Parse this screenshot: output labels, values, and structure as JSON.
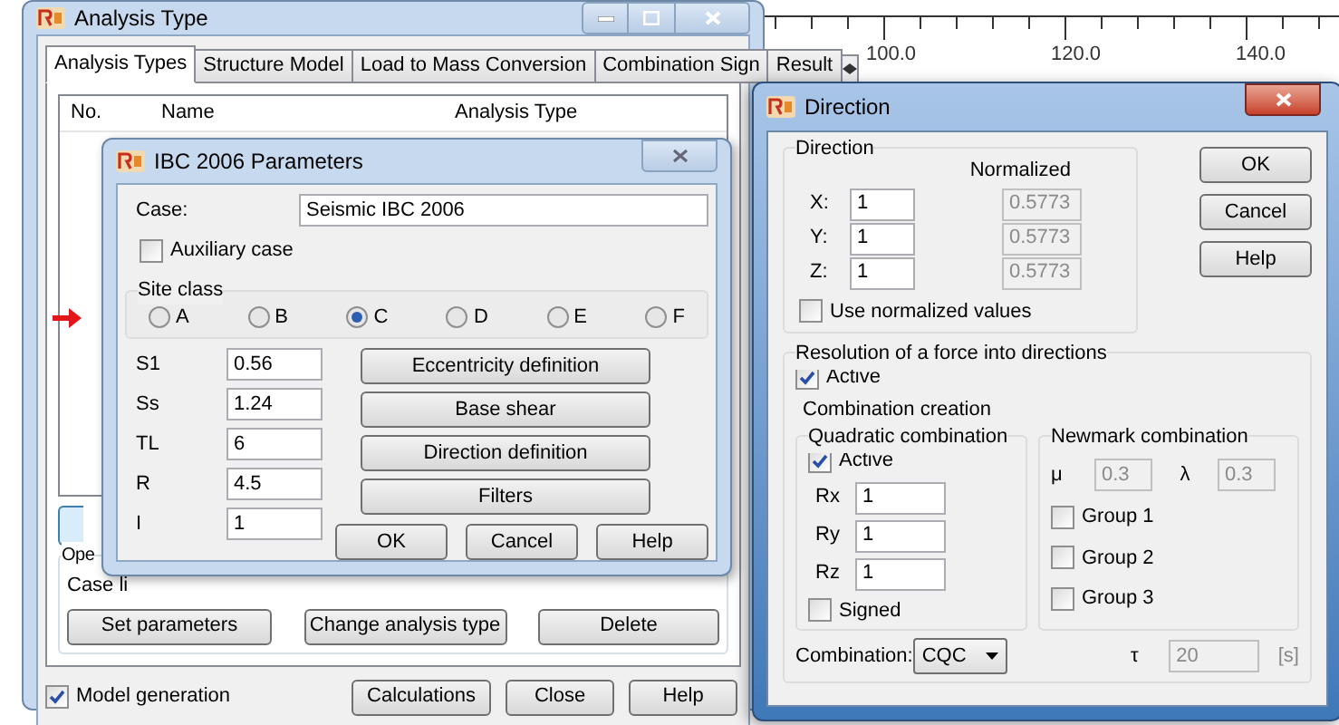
{
  "ruler": {
    "labels": [
      "100.0",
      "120.0",
      "140.0"
    ]
  },
  "analysis_window": {
    "title": "Analysis Type",
    "tabs": [
      {
        "label": "Analysis Types",
        "selected": true
      },
      {
        "label": "Structure Model",
        "selected": false
      },
      {
        "label": "Load to Mass Conversion",
        "selected": false
      },
      {
        "label": "Combination Sign",
        "selected": false
      },
      {
        "label": "Result",
        "selected": false
      }
    ],
    "table": {
      "columns": [
        "No.",
        "Name",
        "Analysis Type"
      ]
    },
    "group_label": "Ope",
    "case_list_label": "Case li",
    "buttons": [
      "Set parameters",
      "Change analysis type",
      "Delete"
    ],
    "model_generation": {
      "label": "Model generation",
      "checked": true
    },
    "footer_buttons": [
      "Calculations",
      "Close",
      "Help"
    ]
  },
  "ibc_window": {
    "title": "IBC 2006 Parameters",
    "case": {
      "label": "Case:",
      "value": "Seismic IBC 2006"
    },
    "auxiliary": {
      "label": "Auxiliary case",
      "checked": false
    },
    "site_class": {
      "label": "Site class",
      "options": [
        {
          "label": "A",
          "selected": false
        },
        {
          "label": "B",
          "selected": false
        },
        {
          "label": "C",
          "selected": true
        },
        {
          "label": "D",
          "selected": false
        },
        {
          "label": "E",
          "selected": false
        },
        {
          "label": "F",
          "selected": false
        }
      ]
    },
    "params": [
      {
        "label": "S1",
        "value": "0.56"
      },
      {
        "label": "Ss",
        "value": "1.24"
      },
      {
        "label": "TL",
        "value": "6"
      },
      {
        "label": "R",
        "value": "4.5"
      },
      {
        "label": "I",
        "value": "1"
      }
    ],
    "action_buttons": [
      "Eccentricity definition",
      "Base shear",
      "Direction definition",
      "Filters"
    ],
    "dialog_buttons": [
      "OK",
      "Cancel",
      "Help"
    ]
  },
  "direction_window": {
    "title": "Direction",
    "direction_group": {
      "label": "Direction",
      "normalized_label": "Normalized",
      "axes": [
        {
          "label": "X:",
          "value": "1",
          "normalized": {
            "value": "0.5773",
            "disabled": true
          }
        },
        {
          "label": "Y:",
          "value": "1",
          "normalized": {
            "value": "0.5773",
            "disabled": true
          }
        },
        {
          "label": "Z:",
          "value": "1",
          "normalized": {
            "value": "0.5773",
            "disabled": true
          }
        }
      ],
      "use_normalized": {
        "label": "Use normalized values",
        "checked": false
      }
    },
    "buttons": [
      "OK",
      "Cancel",
      "Help"
    ],
    "resolution": {
      "label": "Resolution of a force into directions",
      "active": {
        "label": "Active",
        "checked": true
      },
      "combination_label": "Combination creation",
      "quadratic": {
        "label": "Quadratic combination",
        "active": {
          "label": "Active",
          "checked": true
        },
        "fields": [
          {
            "label": "Rx",
            "value": "1"
          },
          {
            "label": "Ry",
            "value": "1"
          },
          {
            "label": "Rz",
            "value": "1"
          }
        ],
        "signed": {
          "label": "Signed",
          "checked": false
        }
      },
      "newmark": {
        "label": "Newmark combination",
        "mu": {
          "label": "μ",
          "value": "0.3",
          "disabled": true
        },
        "lambda": {
          "label": "λ",
          "value": "0.3",
          "disabled": true
        },
        "groups": [
          {
            "label": "Group 1",
            "checked": false
          },
          {
            "label": "Group 2",
            "checked": false
          },
          {
            "label": "Group 3",
            "checked": false
          }
        ]
      },
      "combination": {
        "label": "Combination:",
        "value": "CQC"
      },
      "tau": {
        "label": "τ",
        "value": "20",
        "disabled": true,
        "unit": "[s]"
      }
    }
  }
}
